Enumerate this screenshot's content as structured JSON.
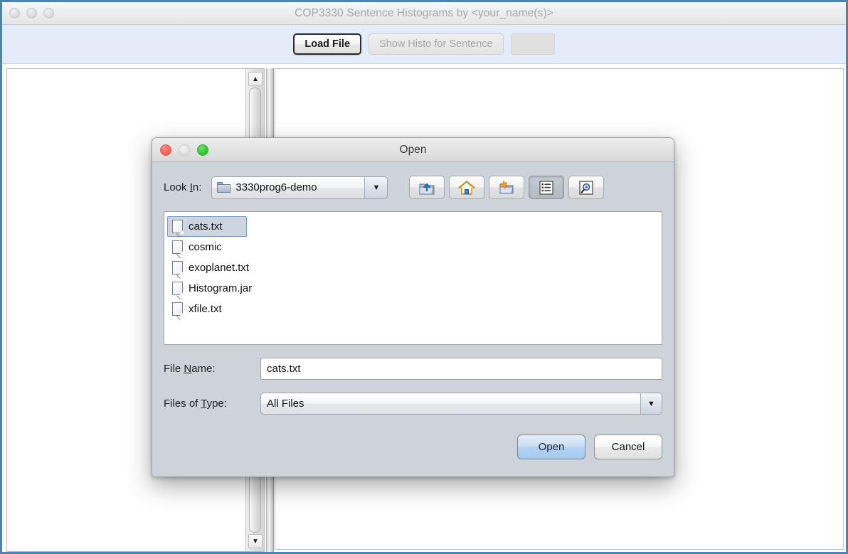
{
  "window": {
    "title": "COP3330 Sentence Histograms by <your_name(s)>",
    "traffic_lights": [
      "close-inactive",
      "minimize-inactive",
      "maximize-inactive"
    ],
    "border_color": "#5082b0"
  },
  "toolbar": {
    "background": "#e4ecfa",
    "load_file_label": "Load File",
    "show_histo_label": "Show Histo for Sentence",
    "show_histo_enabled": false,
    "spacer_label": ""
  },
  "left_pane": {
    "content": "",
    "scrollbar": {
      "up_arrow": "▲",
      "down_arrow": "▼"
    }
  },
  "dialog": {
    "title": "Open",
    "traffic_lights": {
      "close": "#fa6158",
      "minimize": "#e3e3e3",
      "maximize": "#2fcb35"
    },
    "look_in": {
      "label_before": "Look ",
      "label_mnemonic": "I",
      "label_after": "n:",
      "value": "3330prog6-demo",
      "arrow": "▼",
      "folder_icon": "folder-icon"
    },
    "toolbar_icons": [
      {
        "name": "up-folder-icon",
        "pressed": false
      },
      {
        "name": "home-icon",
        "pressed": false
      },
      {
        "name": "new-folder-icon",
        "pressed": false
      },
      {
        "name": "list-view-icon",
        "pressed": true
      },
      {
        "name": "details-view-icon",
        "pressed": false
      }
    ],
    "files": [
      {
        "name": "cats.txt",
        "selected": true
      },
      {
        "name": "cosmic",
        "selected": false
      },
      {
        "name": "exoplanet.txt",
        "selected": false
      },
      {
        "name": "Histogram.jar",
        "selected": false
      },
      {
        "name": "xfile.txt",
        "selected": false
      }
    ],
    "file_name": {
      "label_before": "File ",
      "label_mnemonic": "N",
      "label_after": "ame:",
      "value": "cats.txt",
      "placeholder": ""
    },
    "files_of_type": {
      "label_before": "Files of ",
      "label_mnemonic": "T",
      "label_after": "ype:",
      "value": "All Files",
      "arrow": "▼"
    },
    "actions": {
      "open_label": "Open",
      "cancel_label": "Cancel",
      "default_button": "Open"
    }
  }
}
